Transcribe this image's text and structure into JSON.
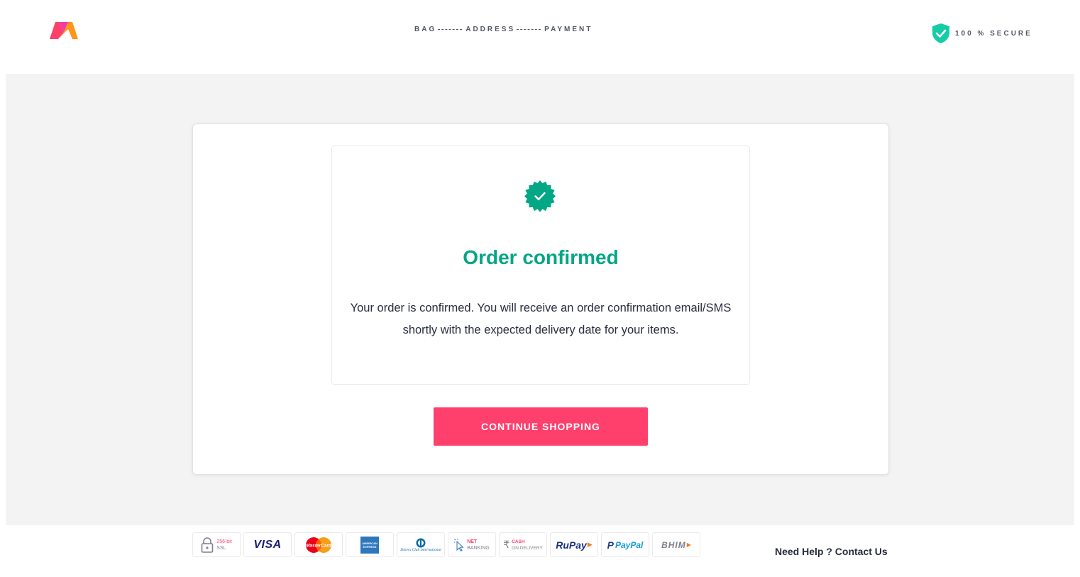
{
  "header": {
    "steps": [
      "BAG",
      "ADDRESS",
      "PAYMENT"
    ],
    "secure_label": "100 % SECURE"
  },
  "confirmation": {
    "title": "Order confirmed",
    "description": "Your order is confirmed. You will receive an order confirmation email/SMS shortly with the expected delivery date for your items.",
    "button_label": "CONTINUE SHOPPING"
  },
  "footer": {
    "payments": [
      {
        "name": "ssl",
        "line1": "256-bit",
        "line2": "SSL"
      },
      {
        "name": "visa",
        "label": "VISA"
      },
      {
        "name": "mastercard",
        "label": "MasterCard"
      },
      {
        "name": "amex",
        "label": "AMERICAN EXPRESS"
      },
      {
        "name": "diners",
        "label": "Diners Club International"
      },
      {
        "name": "net-banking",
        "line1": "NET",
        "line2": "BANKING"
      },
      {
        "name": "cod",
        "line1": "CASH",
        "line2": "ON DELIVERY"
      },
      {
        "name": "rupay",
        "label": "RuPay"
      },
      {
        "name": "paypal",
        "label": "PayPal"
      },
      {
        "name": "bhim",
        "label": "BHIM"
      }
    ],
    "help_text": "Need Help ? Contact Us"
  },
  "colors": {
    "accent": "#ff3f6c",
    "success": "#03a685",
    "secure_green": "#14cda8"
  }
}
